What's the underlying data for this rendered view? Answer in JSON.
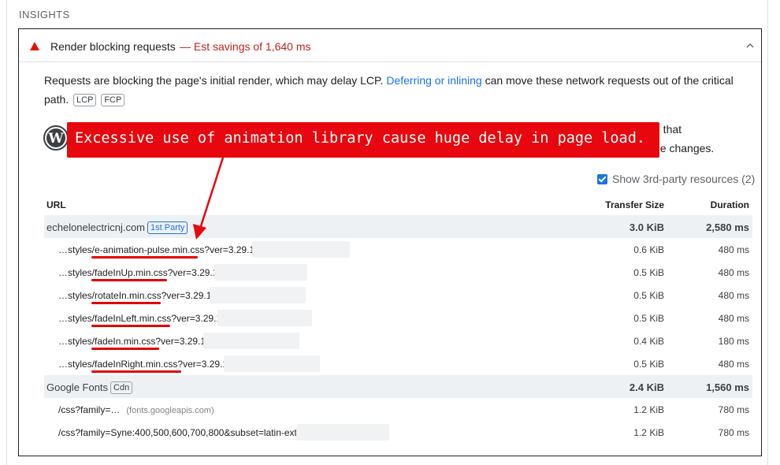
{
  "section_title": "INSIGHTS",
  "audit": {
    "title": "Render blocking requests",
    "savings": "— Est savings of 1,640 ms",
    "description_before": "Requests are blocking the page's initial render, which may delay LCP. ",
    "description_link": "Deferring or inlining",
    "description_after": " can move these network requests out of the critical path.",
    "chips": [
      "LCP",
      "FCP"
    ]
  },
  "wordpress_text": {
    "line1_tail": "e that",
    "line2_tail": "de changes."
  },
  "annotation": {
    "text": "Excessive use of animation library cause huge delay in page load.",
    "color": "#e8070e"
  },
  "third_party": {
    "label": "Show 3rd-party resources (2)",
    "checked": true
  },
  "table": {
    "headers": {
      "url": "URL",
      "size": "Transfer Size",
      "duration": "Duration"
    },
    "groups": [
      {
        "name": "echelonelectricnj.com",
        "badge": "1st Party",
        "size": "3.0 KiB",
        "duration": "2,580 ms",
        "rows": [
          {
            "url": "…styles/e-animation-pulse.min.css?ver=3.29.1",
            "size": "0.6 KiB",
            "duration": "480 ms"
          },
          {
            "url": "…styles/fadeInUp.min.css?ver=3.29.1",
            "size": "0.5 KiB",
            "duration": "480 ms"
          },
          {
            "url": "…styles/rotateIn.min.css?ver=3.29.1",
            "size": "0.5 KiB",
            "duration": "480 ms"
          },
          {
            "url": "…styles/fadeInLeft.min.css?ver=3.29.1",
            "size": "0.5 KiB",
            "duration": "480 ms"
          },
          {
            "url": "…styles/fadeIn.min.css?ver=3.29.1",
            "size": "0.4 KiB",
            "duration": "180 ms"
          },
          {
            "url": "…styles/fadeInRight.min.css?ver=3.29.1",
            "size": "0.5 KiB",
            "duration": "480 ms"
          }
        ]
      },
      {
        "name": "Google Fonts",
        "badge": "Cdn",
        "size": "2.4 KiB",
        "duration": "1,560 ms",
        "rows": [
          {
            "url": "/css?family=…",
            "origin": "(fonts.googleapis.com)",
            "size": "1.2 KiB",
            "duration": "780 ms"
          },
          {
            "url": "/css?family=Syne:400,500,600,700,800&subset=latin-ext",
            "size": "1.2 KiB",
            "duration": "780 ms"
          }
        ]
      }
    ]
  },
  "icons": {
    "warning": "warning-triangle-icon",
    "collapse": "chevron-up-icon",
    "logo": "wordpress-logo-icon",
    "checkbox": "checkbox-checked-icon"
  },
  "colors": {
    "warning": "#eb0f00",
    "savings": "#c5221f",
    "link": "#1a73e8",
    "group_row": "#eef1f3",
    "annotation": "#e8070e"
  }
}
